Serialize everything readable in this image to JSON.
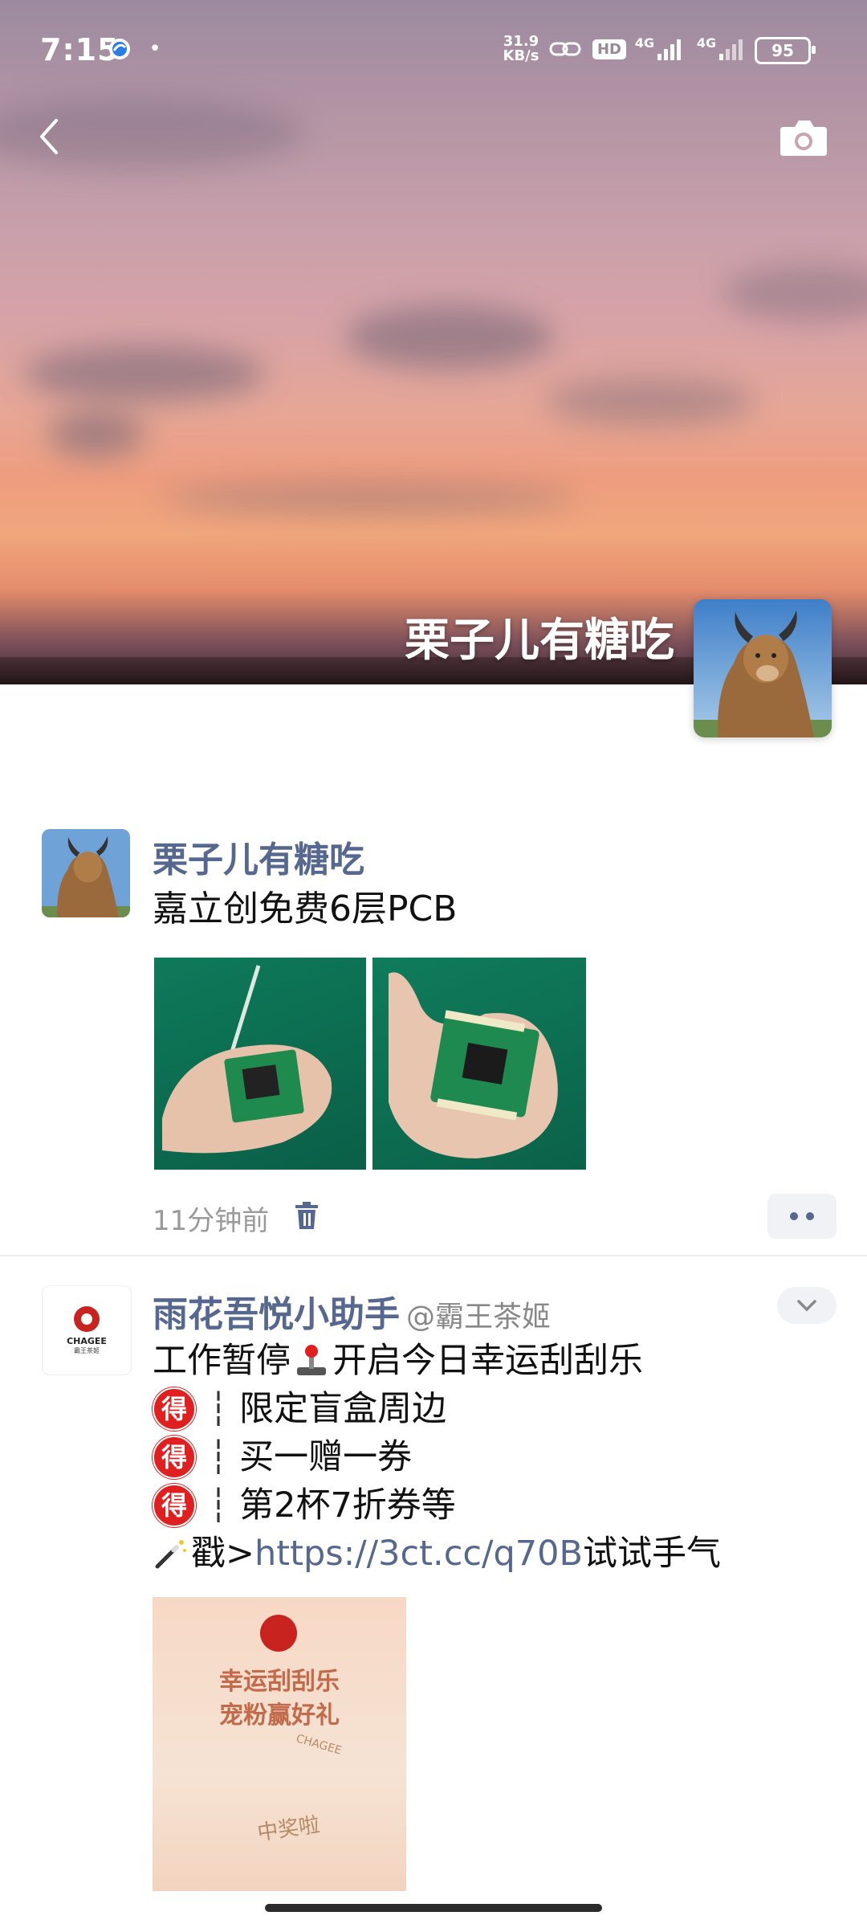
{
  "status_bar": {
    "time": "7:15",
    "net_speed_top": "31.9",
    "net_speed_bottom": "KB/s",
    "hd_label": "HD",
    "signal1": "4G",
    "signal2": "4G",
    "battery": "95"
  },
  "header": {
    "back_icon": "chevron-left-icon",
    "camera_icon": "camera-icon"
  },
  "profile": {
    "cover_name": "栗子儿有糖吃"
  },
  "posts": [
    {
      "author": "栗子儿有糖吃",
      "text": "嘉立创免费6层PCB",
      "time": "11分钟前"
    },
    {
      "author": "雨花吾悦小助手",
      "handle": "@霸王茶姬",
      "logo_text": "CHAGEE",
      "logo_sub": "霸王茶姬",
      "line1_a": "工作暂停",
      "line1_b": "开启今日幸运刮刮乐",
      "badge": "得",
      "item1": "限定盲盒周边",
      "item2": "买一赠一券",
      "item3": "第2杯7折券等",
      "link_prefix": "戳>",
      "link": "https://3ct.cc/q70B",
      "link_suffix": "试试手气",
      "promo_line1": "幸运刮刮乐",
      "promo_line2": "宠粉赢好礼",
      "promo_brand": "CHAGEE",
      "promo_stamp": "中奖啦"
    }
  ],
  "colors": {
    "name_link": "#56688f",
    "badge_red": "#e02020"
  }
}
